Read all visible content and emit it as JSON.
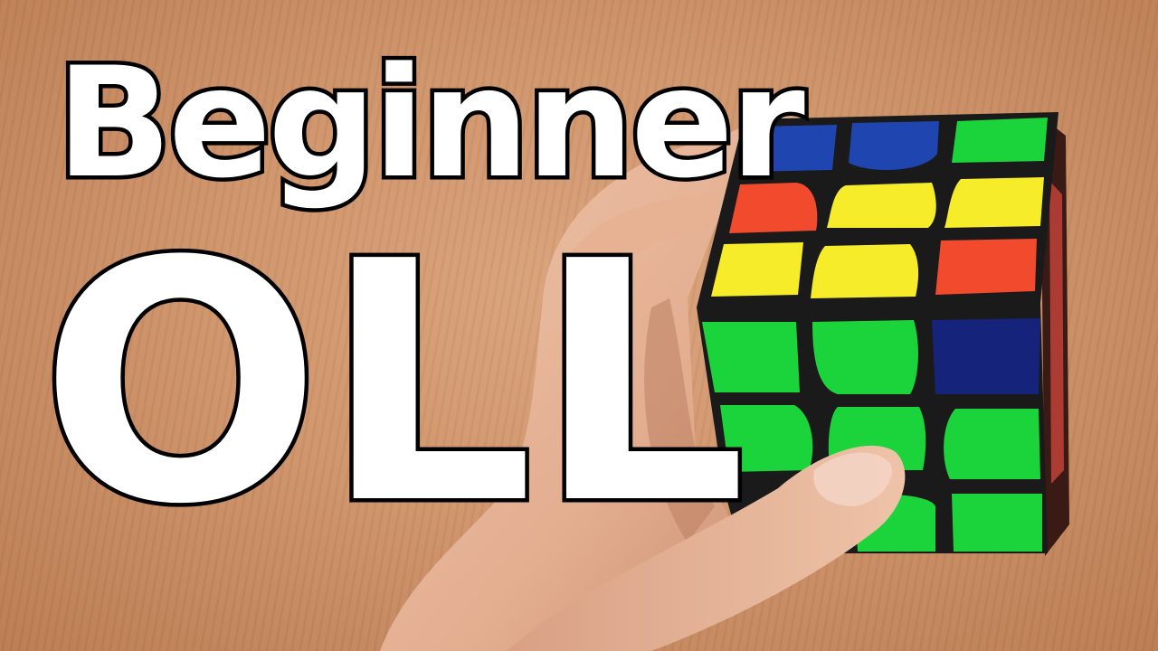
{
  "thumbnail": {
    "title_line_1": "Beginner",
    "title_line_2": "OLL"
  },
  "colors": {
    "background_wood": "#cf946b",
    "title_text": "#ffffff",
    "title_outline": "#000000",
    "skin": "#e7b59a",
    "cube_body": "#1a1a1a",
    "sticker_blue": "#1f46b0",
    "sticker_green": "#1bd43c",
    "sticker_red": "#f14a2d",
    "sticker_yellow": "#f7ec2a",
    "sticker_dark_blue": "#16237a"
  },
  "cube": {
    "top_face": [
      [
        "blue",
        "blue",
        "green"
      ],
      [
        "red",
        "yellow",
        "yellow"
      ],
      [
        "yellow",
        "yellow",
        "red"
      ]
    ],
    "front_face": [
      [
        "green",
        "green",
        "dark_blue"
      ],
      [
        "green",
        "green",
        "green"
      ],
      [
        "green",
        "green",
        "green"
      ]
    ]
  }
}
